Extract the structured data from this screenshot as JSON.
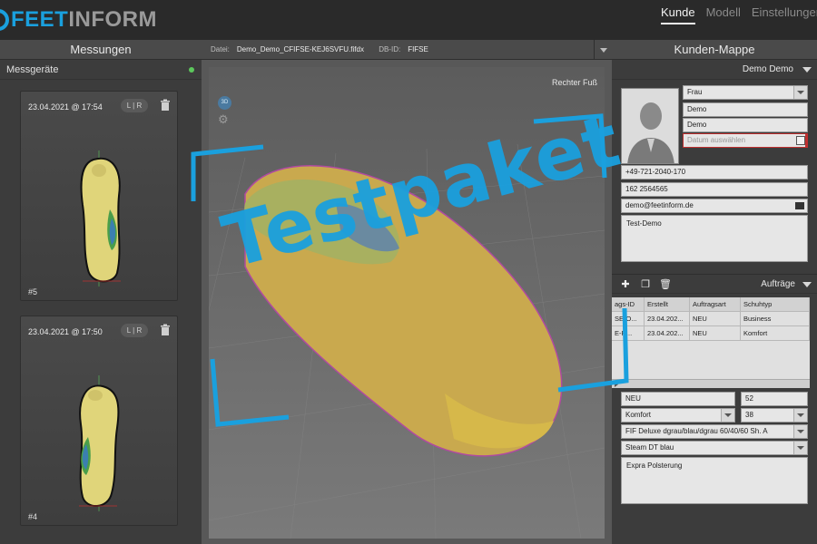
{
  "app": {
    "logo_part1": "FEET",
    "logo_part2": "INFORM"
  },
  "nav": {
    "items": [
      "Kunde",
      "Modell",
      "Einstellungen"
    ],
    "active": "Kunde"
  },
  "left": {
    "title": "Messungen",
    "devices_label": "Messgeräte",
    "cards": [
      {
        "date": "23.04.2021 @ 17:54",
        "lr": "L | R",
        "number": "#5"
      },
      {
        "date": "23.04.2021 @ 17:50",
        "lr": "L | R",
        "number": "#4"
      }
    ]
  },
  "center": {
    "file_label": "Datei:",
    "file_name": "Demo_Demo_CFIFSE-KEJ6SVFU.fifdx",
    "db_label": "DB-ID:",
    "db_value": "FIFSE",
    "side_label": "Rechter Fuß",
    "view_3d": "3D"
  },
  "right": {
    "title": "Kunden-Mappe",
    "customer_name": "Demo Demo",
    "salutation": "Frau",
    "first_name": "Demo",
    "last_name": "Demo",
    "date_placeholder": "Datum auswählen",
    "phone": "+49-721-2040-170",
    "mobile": "162 2564565",
    "email": "demo@feetinform.de",
    "notes": "Test-Demo",
    "orders_label": "Aufträge",
    "table": {
      "headers": [
        "ags-ID",
        "Erstellt",
        "Auftragsart",
        "Schuhtyp"
      ],
      "rows": [
        [
          "SE-O...",
          "23.04.202...",
          "NEU",
          "Business"
        ],
        [
          "E-R...",
          "23.04.202...",
          "NEU",
          "Komfort"
        ]
      ]
    },
    "order_type": "NEU",
    "order_count": "52",
    "comfort_select": "Komfort",
    "size_select": "38",
    "material_select": "FIF Deluxe dgrau/blau/dgrau 60/40/60 Sh. A",
    "cover_select": "Steam DT blau",
    "extra_notes": "Expra Polsterung"
  },
  "watermark": {
    "text": "Testpaket"
  },
  "colors": {
    "accent": "#1aa0de",
    "status_ok": "#5cc85c",
    "required": "#c03030"
  }
}
